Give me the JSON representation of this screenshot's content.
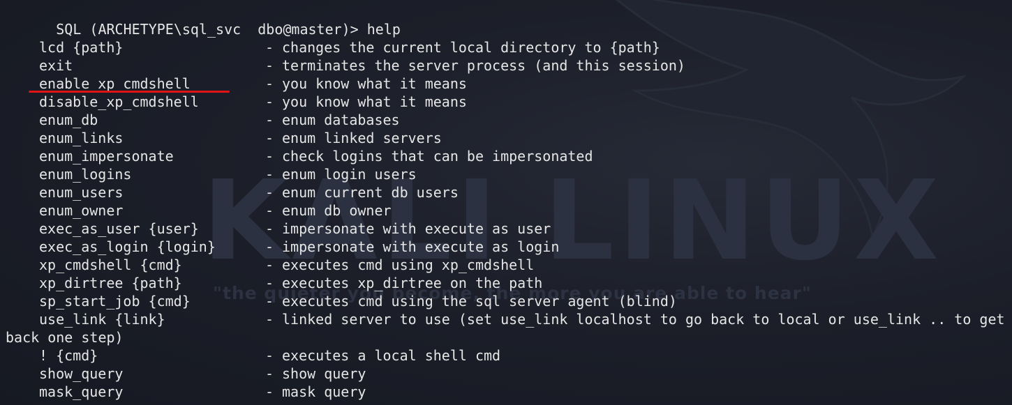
{
  "prompt": {
    "text": "SQL (ARCHETYPE\\sql_svc  dbo@master)> help"
  },
  "watermark": {
    "title": "KALI LINUX",
    "tagline": "\"the quieter you become, the more you are able to hear\""
  },
  "help_entries": [
    {
      "cmd": "lcd {path}",
      "desc": "changes the current local directory to {path}"
    },
    {
      "cmd": "exit",
      "desc": "terminates the server process (and this session)"
    },
    {
      "cmd": "enable_xp_cmdshell",
      "desc": "you know what it means"
    },
    {
      "cmd": "disable_xp_cmdshell",
      "desc": "you know what it means"
    },
    {
      "cmd": "enum_db",
      "desc": "enum databases"
    },
    {
      "cmd": "enum_links",
      "desc": "enum linked servers"
    },
    {
      "cmd": "enum_impersonate",
      "desc": "check logins that can be impersonated"
    },
    {
      "cmd": "enum_logins",
      "desc": "enum login users"
    },
    {
      "cmd": "enum_users",
      "desc": "enum current db users"
    },
    {
      "cmd": "enum_owner",
      "desc": "enum db owner"
    },
    {
      "cmd": "exec_as_user {user}",
      "desc": "impersonate with execute as user"
    },
    {
      "cmd": "exec_as_login {login}",
      "desc": "impersonate with execute as login"
    },
    {
      "cmd": "xp_cmdshell {cmd}",
      "desc": "executes cmd using xp_cmdshell"
    },
    {
      "cmd": "xp_dirtree {path}",
      "desc": "executes xp_dirtree on the path"
    },
    {
      "cmd": "sp_start_job {cmd}",
      "desc": "executes cmd using the sql server agent (blind)"
    },
    {
      "cmd": "use_link {link}",
      "desc": "linked server to use (set use_link localhost to go back to local or use_link .. to get"
    },
    {
      "cmd": "",
      "desc": "",
      "wrap": "back one step)"
    },
    {
      "cmd": "! {cmd}",
      "desc": "executes a local shell cmd"
    },
    {
      "cmd": "show_query",
      "desc": "show query"
    },
    {
      "cmd": "mask_query",
      "desc": "mask query"
    }
  ],
  "dash": "-",
  "colors": {
    "background": "#1c1f29",
    "text": "#e6e6e6",
    "annotation_underline": "#e01414"
  }
}
